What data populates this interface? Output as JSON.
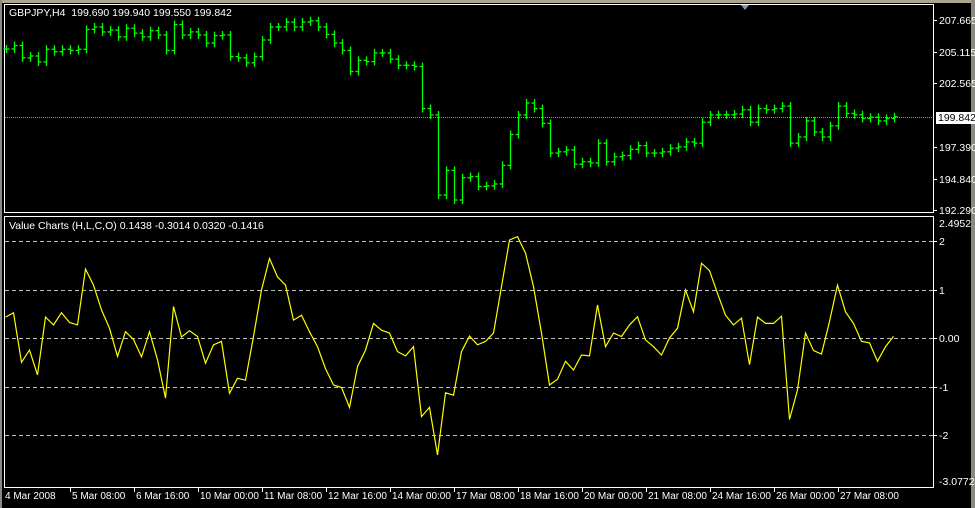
{
  "price_panel": {
    "symbol_timeframe": "GBPJPY,H4",
    "ohlc_readout": "199.690 199.940 199.550 199.842",
    "axis_labels": [
      "207.665",
      "205.115",
      "202.565",
      "199.842",
      "197.390",
      "194.840",
      "192.290"
    ],
    "current_price": "199.842",
    "bar_color": "#00ff00",
    "closes": [
      205.32,
      205.6,
      204.6,
      204.75,
      204.27,
      205.3,
      205.1,
      205.3,
      205.2,
      205.3,
      206.9,
      207.1,
      206.7,
      206.85,
      206.3,
      207.0,
      206.6,
      206.3,
      206.8,
      206.45,
      205.2,
      207.3,
      206.45,
      206.7,
      206.45,
      205.8,
      206.4,
      206.45,
      204.7,
      204.6,
      204.2,
      204.7,
      206.05,
      207.1,
      207.1,
      207.5,
      207.1,
      207.5,
      207.6,
      207.1,
      206.5,
      205.8,
      205.2,
      203.5,
      204.4,
      204.3,
      205.0,
      205.0,
      204.5,
      204.0,
      204.0,
      203.9,
      200.5,
      199.98,
      193.5,
      195.5,
      193.1,
      194.9,
      195.0,
      194.2,
      194.25,
      194.4,
      195.9,
      198.4,
      199.98,
      200.95,
      200.5,
      199.3,
      196.9,
      197.0,
      197.15,
      196.0,
      196.2,
      196.1,
      197.7,
      196.2,
      196.6,
      196.7,
      197.2,
      197.5,
      196.9,
      196.9,
      197.0,
      197.3,
      197.4,
      197.8,
      197.7,
      199.4,
      199.98,
      200.0,
      200.0,
      200.06,
      200.4,
      199.4,
      200.5,
      200.4,
      200.5,
      200.7,
      197.7,
      198.2,
      199.5,
      198.6,
      198.2,
      199.1,
      200.7,
      200.1,
      200.0,
      199.7,
      199.8,
      199.5,
      199.7,
      199.842
    ]
  },
  "indicator_panel": {
    "name": "Value Charts (H,L,C,O)",
    "readout": "0.1438 -0.3014 0.0320 -0.1416",
    "axis_top": "2.4952",
    "axis_bottom": "-3.0772",
    "levels": [
      2,
      1,
      0,
      -1,
      -2
    ],
    "level_labels": [
      "2",
      "1",
      "0.00",
      "-1",
      "-2"
    ],
    "line_color": "#ffff00",
    "closes": [
      0.43,
      0.52,
      -0.5,
      -0.25,
      -0.76,
      0.43,
      0.27,
      0.52,
      0.32,
      0.27,
      1.42,
      1.09,
      0.58,
      0.2,
      -0.38,
      0.13,
      -0.03,
      -0.39,
      0.13,
      -0.45,
      -1.24,
      0.65,
      0.02,
      0.15,
      0.03,
      -0.52,
      -0.14,
      -0.07,
      -1.14,
      -0.83,
      -0.87,
      0.03,
      0.99,
      1.64,
      1.26,
      1.09,
      0.37,
      0.47,
      0.13,
      -0.18,
      -0.63,
      -0.97,
      -1.02,
      -1.43,
      -0.59,
      -0.25,
      0.3,
      0.16,
      0.1,
      -0.28,
      -0.37,
      -0.18,
      -1.62,
      -1.43,
      -2.41,
      -1.13,
      -1.18,
      -0.28,
      0.04,
      -0.14,
      -0.07,
      0.1,
      1.06,
      2.02,
      2.09,
      1.75,
      1.06,
      0.1,
      -0.97,
      -0.85,
      -0.48,
      -0.66,
      -0.35,
      -0.37,
      0.68,
      -0.18,
      0.1,
      0.03,
      0.27,
      0.44,
      -0.04,
      -0.18,
      -0.35,
      0.0,
      0.2,
      0.99,
      0.54,
      1.54,
      1.39,
      0.92,
      0.47,
      0.27,
      0.41,
      -0.55,
      0.43,
      0.3,
      0.3,
      0.45,
      -1.68,
      -1.07,
      0.1,
      -0.26,
      -0.33,
      0.34,
      1.09,
      0.54,
      0.3,
      -0.07,
      -0.1,
      -0.48,
      -0.18,
      0.032
    ]
  },
  "time_axis": [
    "4 Mar 2008",
    "5 Mar 08:00",
    "6 Mar 16:00",
    "10 Mar 00:00",
    "11 Mar 08:00",
    "12 Mar 16:00",
    "14 Mar 00:00",
    "17 Mar 08:00",
    "18 Mar 16:00",
    "20 Mar 00:00",
    "21 Mar 08:00",
    "24 Mar 16:00",
    "26 Mar 00:00",
    "27 Mar 08:00"
  ]
}
